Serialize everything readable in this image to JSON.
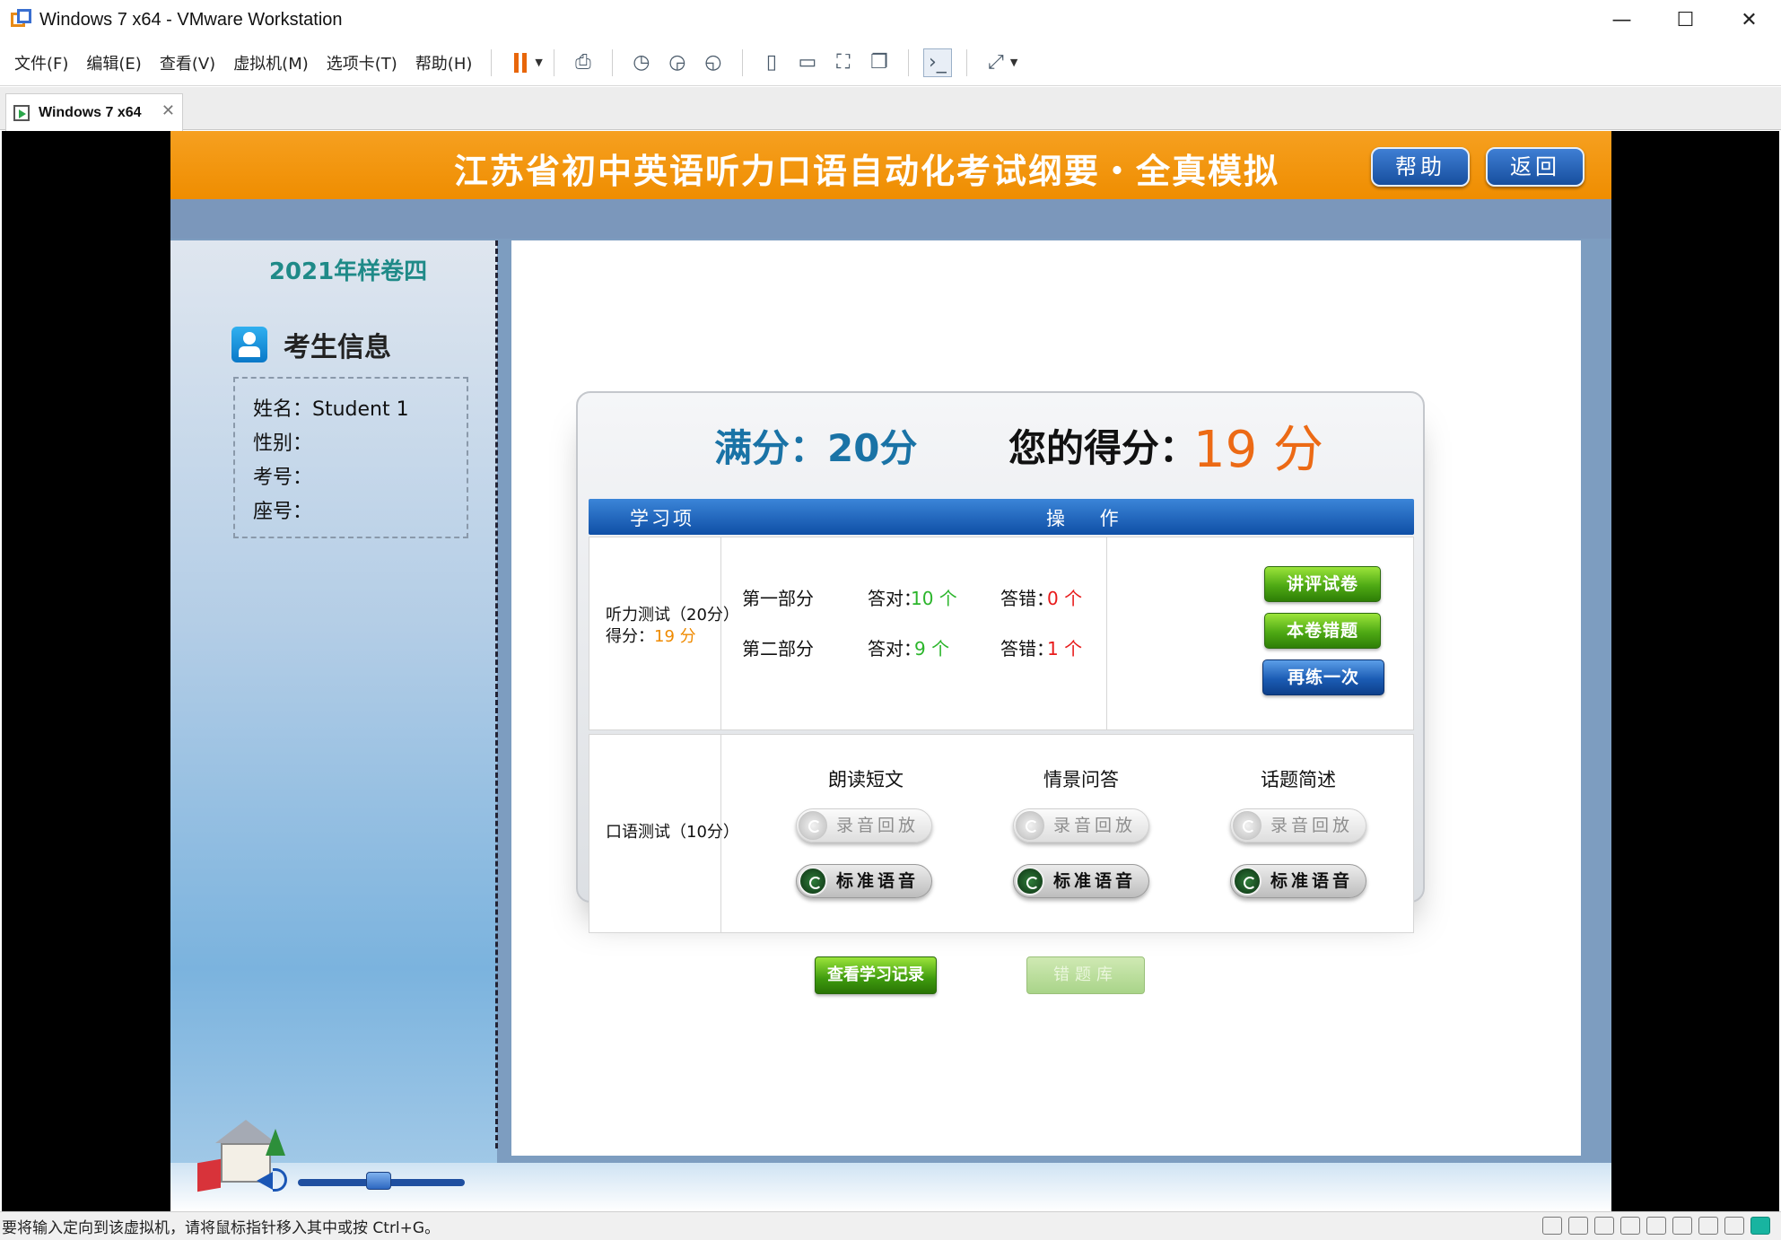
{
  "window": {
    "title": "Windows 7 x64 - VMware Workstation",
    "controls": {
      "minimize": "—",
      "maximize": "☐",
      "close": "✕"
    }
  },
  "menubar": {
    "items": [
      "文件(F)",
      "编辑(E)",
      "查看(V)",
      "虚拟机(M)",
      "选项卡(T)",
      "帮助(H)"
    ],
    "toolbar_icons": [
      "pause-icon",
      "send-keys-icon",
      "snapshot-icon",
      "revert-snapshot-icon",
      "snapshot-manager-icon",
      "library-icon",
      "console-view-icon",
      "fullscreen-icon",
      "unity-icon",
      "terminal-icon",
      "stretch-icon"
    ]
  },
  "tab": {
    "label": "Windows 7 x64",
    "close": "✕"
  },
  "statusbar": {
    "text": "要将输入定向到该虚拟机，请将鼠标指针移入其中或按 Ctrl+G。"
  },
  "app": {
    "title": "江苏省初中英语听力口语自动化考试纲要・全真模拟",
    "help_button": "帮助",
    "back_button": "返回",
    "paper_name": "2021年样卷四",
    "student_info": {
      "heading": "考生信息",
      "name": "姓名：Student 1",
      "gender": "性别：",
      "exam_no": "考号：",
      "seat_no": "座号："
    },
    "score": {
      "full_label": "满分：20分",
      "your_label": "您的得分：",
      "your_value": "19 分"
    },
    "table": {
      "col_item": "学习项",
      "col_op": "操 作",
      "listening": {
        "label": "听力测试（20分）",
        "score_label": "得分：",
        "score_value": "19 分",
        "parts": [
          {
            "name": "第一部分",
            "right_label": "答对：",
            "right_value": "10 个",
            "wrong_label": "答错：",
            "wrong_value": "0 个"
          },
          {
            "name": "第二部分",
            "right_label": "答对：",
            "right_value": "9 个",
            "wrong_label": "答错：",
            "wrong_value": "1 个"
          }
        ],
        "buttons": [
          "讲评试卷",
          "本卷错题",
          "再练一次"
        ]
      },
      "speaking": {
        "label": "口语测试（10分）",
        "sections": [
          {
            "name": "朗读短文",
            "playback": "录音回放",
            "standard": "标准语音"
          },
          {
            "name": "情景问答",
            "playback": "录音回放",
            "standard": "标准语音"
          },
          {
            "name": "话题简述",
            "playback": "录音回放",
            "standard": "标准语音"
          }
        ]
      }
    },
    "view_records_button": "查看学习记录",
    "error_bank_button": "错题库",
    "volume_level": 0.4
  }
}
